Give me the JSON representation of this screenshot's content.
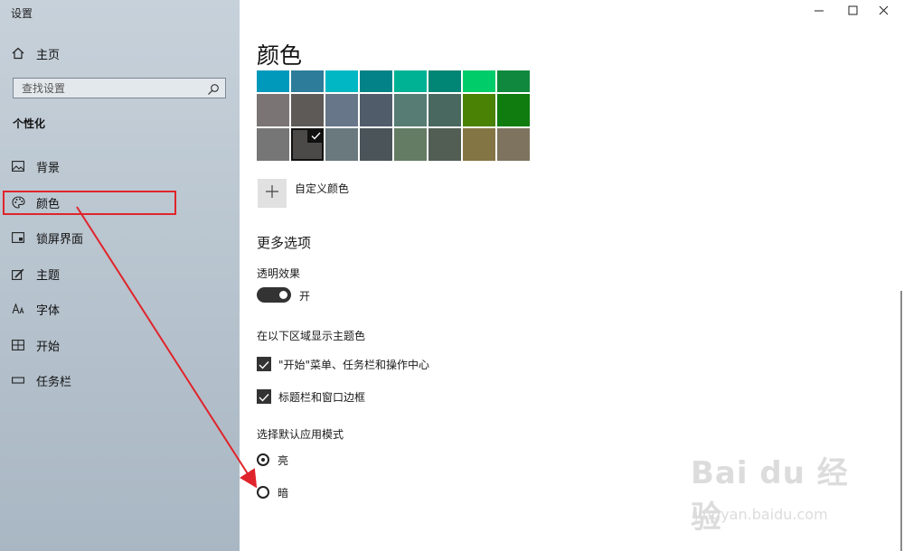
{
  "app": {
    "title": "设置"
  },
  "window_controls": {
    "minimize": "minimize-icon",
    "maximize": "maximize-icon",
    "close": "close-icon"
  },
  "sidebar": {
    "home_label": "主页",
    "search_placeholder": "查找设置",
    "section_title": "个性化",
    "items": [
      {
        "label": "背景",
        "icon": "picture-icon"
      },
      {
        "label": "颜色",
        "icon": "palette-icon"
      },
      {
        "label": "锁屏界面",
        "icon": "lock-screen-icon"
      },
      {
        "label": "主题",
        "icon": "theme-brush-icon"
      },
      {
        "label": "字体",
        "icon": "font-icon"
      },
      {
        "label": "开始",
        "icon": "start-grid-icon"
      },
      {
        "label": "任务栏",
        "icon": "taskbar-icon"
      }
    ]
  },
  "main": {
    "title": "颜色",
    "swatch_rows": [
      [
        "#0099bc",
        "#2d7d9a",
        "#00b7c3",
        "#038387",
        "#00b294",
        "#018574",
        "#00cc6a",
        "#10893e"
      ],
      [
        "#7a7574",
        "#5d5a58",
        "#68768a",
        "#515c6b",
        "#567c73",
        "#486860",
        "#498205",
        "#107c10"
      ],
      [
        "#767676",
        "#4c4a48",
        "#69797e",
        "#4a5459",
        "#647c64",
        "#525e54",
        "#847545",
        "#7e735f"
      ]
    ],
    "selected_swatch": {
      "row": 2,
      "col": 1
    },
    "custom_color_label": "自定义颜色",
    "more_options_title": "更多选项",
    "transparency": {
      "label": "透明效果",
      "state": "开"
    },
    "accent_surfaces": {
      "label": "在以下区域显示主题色",
      "options": [
        {
          "label": "\"开始\"菜单、任务栏和操作中心",
          "checked": true
        },
        {
          "label": "标题栏和窗口边框",
          "checked": true
        }
      ]
    },
    "app_mode": {
      "label": "选择默认应用模式",
      "options": [
        {
          "label": "亮",
          "selected": true
        },
        {
          "label": "暗",
          "selected": false
        }
      ]
    }
  },
  "watermark": {
    "brand": "Bai du 经验",
    "url": "jingyan.baidu.com"
  },
  "colors": {
    "highlight": "#e0242b",
    "arrow": "#e0242b",
    "sidebar_bg": "#b9c5cf"
  }
}
